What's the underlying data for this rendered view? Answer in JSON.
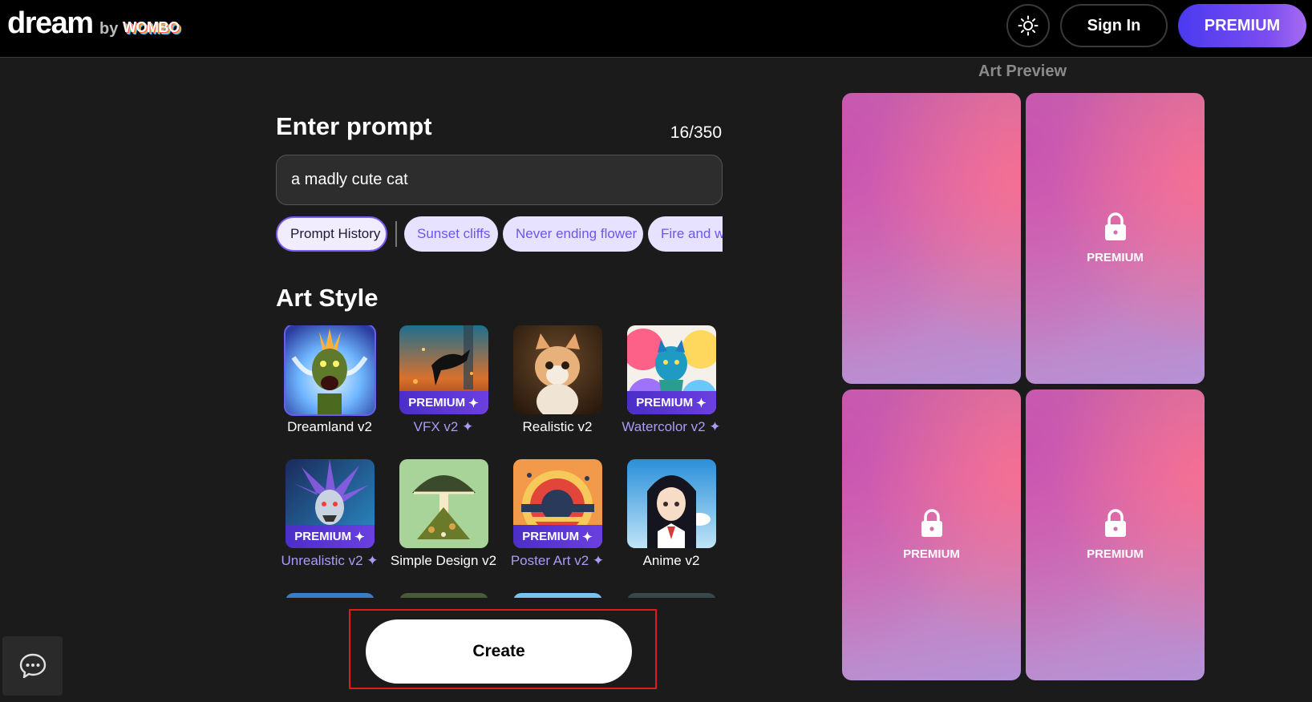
{
  "header": {
    "logo_dream": "dream",
    "logo_by": "by",
    "logo_wombo": "WOMBO",
    "theme_icon": "sun-icon",
    "signin_label": "Sign In",
    "premium_label": "PREMIUM"
  },
  "prompt": {
    "title": "Enter prompt",
    "counter": "16/350",
    "value": "a madly cute cat",
    "history_label": "Prompt History",
    "ideas": [
      "Sunset cliffs",
      "Never ending flower",
      "Fire and water"
    ]
  },
  "art_style": {
    "title": "Art Style",
    "premium_badge": "PREMIUM",
    "sparkle": "✦",
    "styles": [
      {
        "label": "Dreamland v2",
        "premium": false,
        "selected": true
      },
      {
        "label": "VFX v2",
        "premium": true,
        "selected": false
      },
      {
        "label": "Realistic v2",
        "premium": false,
        "selected": false
      },
      {
        "label": "Watercolor v2",
        "premium": true,
        "selected": false
      },
      {
        "label": "Unrealistic v2",
        "premium": true,
        "selected": false
      },
      {
        "label": "Simple Design v2",
        "premium": false,
        "selected": false
      },
      {
        "label": "Poster Art v2",
        "premium": true,
        "selected": false
      },
      {
        "label": "Anime v2",
        "premium": false,
        "selected": false
      }
    ]
  },
  "create_label": "Create",
  "chat_icon": "chat-bubble-icon",
  "preview": {
    "title": "Art Preview",
    "locked_label": "PREMIUM",
    "lock_icon": "lock-icon"
  },
  "colors": {
    "accent": "#6b5cf2",
    "premium_gradient_start": "#4a3af0",
    "highlight_border": "#e01b1b"
  }
}
